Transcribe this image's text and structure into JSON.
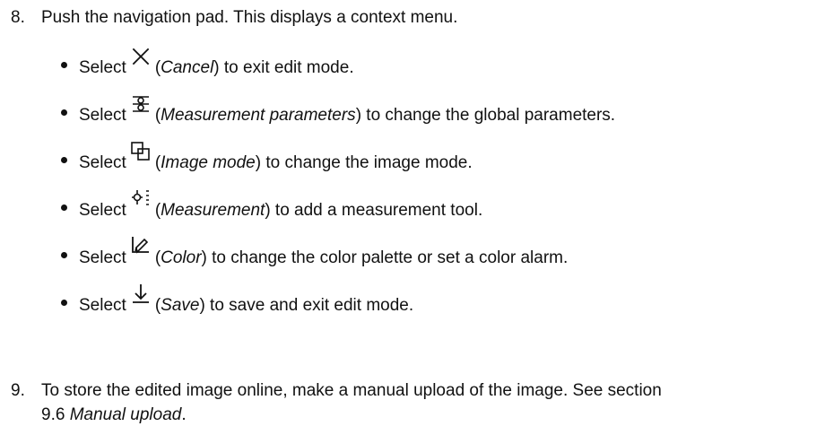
{
  "steps": [
    {
      "number": "8.",
      "text": "Push the navigation pad. This displays a context menu."
    },
    {
      "number": "9.",
      "line1": "To store the edited image online, make a manual upload of the image. See section",
      "line2_prefix": "9.6 ",
      "line2_link": "Manual upload",
      "line2_suffix": "."
    }
  ],
  "bullets": [
    {
      "prefix": "Select",
      "icon": "close-x-icon",
      "open_paren": "(",
      "label": "Cancel",
      "close_paren": ")",
      "text": " to exit edit mode."
    },
    {
      "prefix": "Select",
      "icon": "sliders-icon",
      "open_paren": "(",
      "label": "Measurement parameters",
      "close_paren": ")",
      "text": " to change the global parameters."
    },
    {
      "prefix": "Select",
      "icon": "image-mode-icon",
      "open_paren": "(",
      "label": "Image mode",
      "close_paren": ")",
      "text": " to change the image mode."
    },
    {
      "prefix": "Select",
      "icon": "measurement-icon",
      "open_paren": "(",
      "label": "Measurement",
      "close_paren": ")",
      "text": " to add a measurement tool."
    },
    {
      "prefix": "Select",
      "icon": "color-icon",
      "open_paren": "(",
      "label": "Color",
      "close_paren": ")",
      "text": " to change the color palette or set a color alarm."
    },
    {
      "prefix": "Select",
      "icon": "save-icon",
      "open_paren": "(",
      "label": "Save",
      "close_paren": ")",
      "text": " to save and exit edit mode."
    }
  ],
  "colors": {
    "text": "#111111",
    "background": "#ffffff"
  }
}
